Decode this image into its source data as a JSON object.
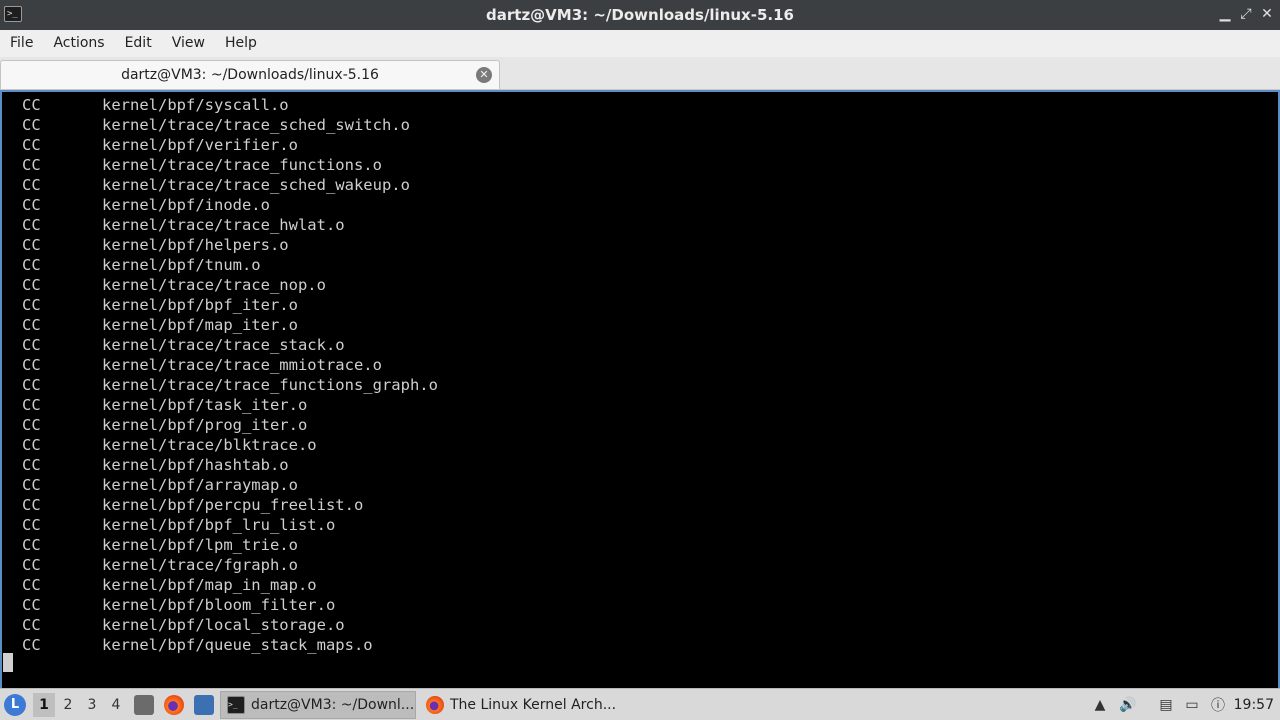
{
  "window": {
    "title": "dartz@VM3: ~/Downloads/linux-5.16",
    "minimize_glyph": "▁",
    "maximize_glyph": "⤢",
    "close_glyph": "✕"
  },
  "menubar": {
    "items": [
      "File",
      "Actions",
      "Edit",
      "View",
      "Help"
    ]
  },
  "tab": {
    "label": "dartz@VM3: ~/Downloads/linux-5.16",
    "close_glyph": "✕"
  },
  "terminal": {
    "lines": [
      {
        "cmd": "CC",
        "path": "kernel/bpf/syscall.o"
      },
      {
        "cmd": "CC",
        "path": "kernel/trace/trace_sched_switch.o"
      },
      {
        "cmd": "CC",
        "path": "kernel/bpf/verifier.o"
      },
      {
        "cmd": "CC",
        "path": "kernel/trace/trace_functions.o"
      },
      {
        "cmd": "CC",
        "path": "kernel/trace/trace_sched_wakeup.o"
      },
      {
        "cmd": "CC",
        "path": "kernel/bpf/inode.o"
      },
      {
        "cmd": "CC",
        "path": "kernel/trace/trace_hwlat.o"
      },
      {
        "cmd": "CC",
        "path": "kernel/bpf/helpers.o"
      },
      {
        "cmd": "CC",
        "path": "kernel/bpf/tnum.o"
      },
      {
        "cmd": "CC",
        "path": "kernel/trace/trace_nop.o"
      },
      {
        "cmd": "CC",
        "path": "kernel/bpf/bpf_iter.o"
      },
      {
        "cmd": "CC",
        "path": "kernel/bpf/map_iter.o"
      },
      {
        "cmd": "CC",
        "path": "kernel/trace/trace_stack.o"
      },
      {
        "cmd": "CC",
        "path": "kernel/trace/trace_mmiotrace.o"
      },
      {
        "cmd": "CC",
        "path": "kernel/trace/trace_functions_graph.o"
      },
      {
        "cmd": "CC",
        "path": "kernel/bpf/task_iter.o"
      },
      {
        "cmd": "CC",
        "path": "kernel/bpf/prog_iter.o"
      },
      {
        "cmd": "CC",
        "path": "kernel/trace/blktrace.o"
      },
      {
        "cmd": "CC",
        "path": "kernel/bpf/hashtab.o"
      },
      {
        "cmd": "CC",
        "path": "kernel/bpf/arraymap.o"
      },
      {
        "cmd": "CC",
        "path": "kernel/bpf/percpu_freelist.o"
      },
      {
        "cmd": "CC",
        "path": "kernel/bpf/bpf_lru_list.o"
      },
      {
        "cmd": "CC",
        "path": "kernel/bpf/lpm_trie.o"
      },
      {
        "cmd": "CC",
        "path": "kernel/trace/fgraph.o"
      },
      {
        "cmd": "CC",
        "path": "kernel/bpf/map_in_map.o"
      },
      {
        "cmd": "CC",
        "path": "kernel/bpf/bloom_filter.o"
      },
      {
        "cmd": "CC",
        "path": "kernel/bpf/local_storage.o"
      },
      {
        "cmd": "CC",
        "path": "kernel/bpf/queue_stack_maps.o"
      }
    ]
  },
  "taskbar": {
    "workspaces": [
      "1",
      "2",
      "3",
      "4"
    ],
    "active_workspace": "1",
    "tasks": [
      {
        "label": "dartz@VM3: ~/Downl...",
        "icon": "terminal-icon"
      },
      {
        "label": "The Linux Kernel Arch...",
        "icon": "firefox-icon"
      }
    ],
    "clock": "19:57"
  },
  "colors": {
    "accent": "#5a8ec7",
    "terminal_bg": "#000000",
    "terminal_fg": "#cfcfcf"
  }
}
